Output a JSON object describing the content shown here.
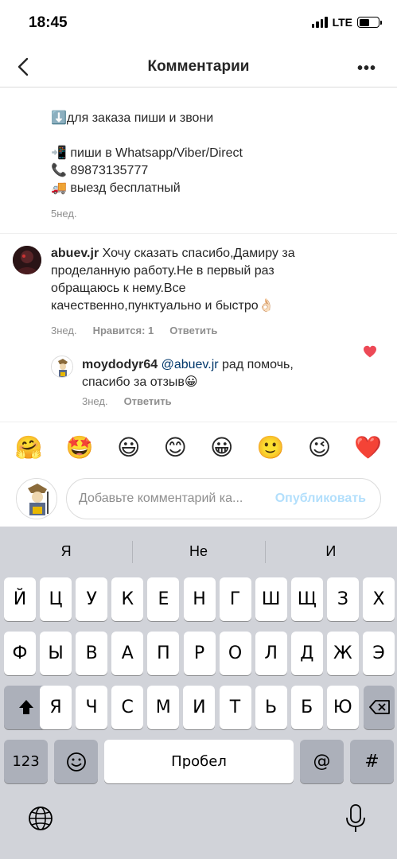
{
  "status_bar": {
    "time": "18:45",
    "network": "LTE"
  },
  "header": {
    "title": "Комментарии",
    "more": "•••"
  },
  "post_tail": {
    "lines": [
      "⬇️для заказа пиши и звони",
      "",
      "📲 пиши в Whatsapp/Viber/Direct",
      "📞 89873135777",
      "🚚 выезд бесплатный"
    ],
    "time": "5нед."
  },
  "comments": [
    {
      "username": "abuev.jr",
      "text_lines": [
        "Хочу сказать спасибо,Дамиру за",
        "проделанную работу.Не в первый раз",
        "обращаюсь к нему.Все",
        "качественно,пунктуально и быстро👌🏻"
      ],
      "time": "3нед.",
      "likes": "Нравится: 1",
      "reply": "Ответить",
      "liked": true
    },
    {
      "username": "moydodyr64",
      "mention": "@abuev.jr",
      "text_first": "рад помочь,",
      "text_second": "спасибо за отзыв😀",
      "time": "3нед.",
      "reply": "Ответить",
      "liked": false
    }
  ],
  "emoji_bar": [
    "🤗",
    "🤩",
    "😃",
    "😊",
    "😀",
    "🙂",
    "😉",
    "❤️"
  ],
  "composer": {
    "placeholder": "Добавьте комментарий ка...",
    "publish": "Опубликовать"
  },
  "keyboard": {
    "suggestions": [
      "Я",
      "Не",
      "И"
    ],
    "row1": [
      "Й",
      "Ц",
      "У",
      "К",
      "Е",
      "Н",
      "Г",
      "Ш",
      "Щ",
      "З",
      "Х"
    ],
    "row2": [
      "Ф",
      "Ы",
      "В",
      "А",
      "П",
      "Р",
      "О",
      "Л",
      "Д",
      "Ж",
      "Э"
    ],
    "row3": [
      "Я",
      "Ч",
      "С",
      "М",
      "И",
      "Т",
      "Ь",
      "Б",
      "Ю"
    ],
    "numbers": "123",
    "space": "Пробел",
    "at": "@",
    "hash": "#"
  },
  "colors": {
    "like_red": "#ed4956",
    "link_blue": "#00376b",
    "publish_disabled": "#b2dffc",
    "keyboard_bg": "#d1d3d9"
  }
}
